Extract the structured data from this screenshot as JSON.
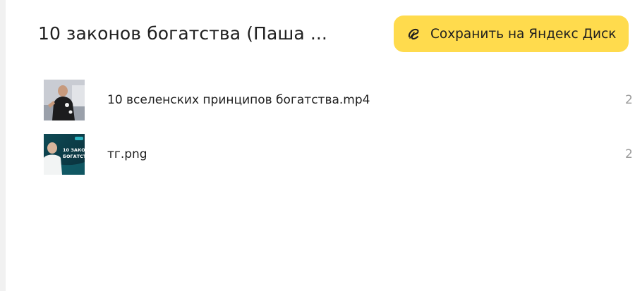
{
  "folder": {
    "title": "10 законов богатства (Паша ..."
  },
  "actions": {
    "save_label": "Сохранить на Яндекс Диск",
    "save_icon": "yandex-disk-icon",
    "accent_color": "#ffdb4d"
  },
  "files": [
    {
      "name": "10 вселенских принципов богатства.mp4",
      "date": "2",
      "thumbnail": "video-thumbnail-icon"
    },
    {
      "name": "тг.png",
      "date": "2",
      "thumbnail": "image-thumbnail-icon",
      "thumb_text": "10 ЗАКОН БОГАТСТ"
    }
  ]
}
